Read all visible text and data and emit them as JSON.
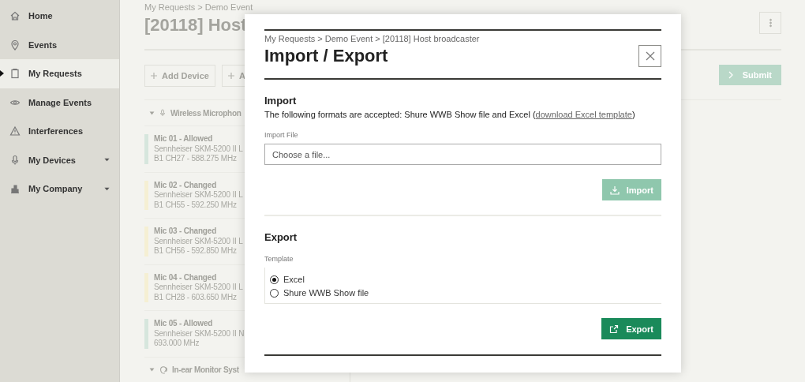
{
  "sidebar": {
    "items": [
      {
        "label": "Home",
        "selected": false,
        "submenu": false
      },
      {
        "label": "Events",
        "selected": false,
        "submenu": false
      },
      {
        "label": "My Requests",
        "selected": true,
        "submenu": false
      },
      {
        "label": "Manage Events",
        "selected": false,
        "submenu": false
      },
      {
        "label": "Interferences",
        "selected": false,
        "submenu": false
      },
      {
        "label": "My Devices",
        "selected": false,
        "submenu": true
      },
      {
        "label": "My Company",
        "selected": false,
        "submenu": true
      }
    ]
  },
  "page": {
    "breadcrumb": "My Requests > Demo Event",
    "title": "[20118] Host",
    "toolbar_buttons": [
      "Add Device",
      "A"
    ],
    "submit": {
      "label": "Submit",
      "disabled": true
    },
    "groups": [
      {
        "label": "Wireless Microphon",
        "expanded": true,
        "items": [
          {
            "name": "Mic 01 - Allowed",
            "model": "Sennheiser SKM-5200 II L",
            "frequency": "B1 CH27 - 588.275 MHz",
            "color": "#d6e6dd"
          },
          {
            "name": "Mic 02 - Changed",
            "model": "Sennheiser SKM-5200 II L",
            "frequency": "B1 CH55 - 592.250 MHz",
            "color": "#f5efd3"
          },
          {
            "name": "Mic 03 - Changed",
            "model": "Sennheiser SKM-5200 II L",
            "frequency": "B1 CH56 - 592.850 MHz",
            "color": "#f5efd3"
          },
          {
            "name": "Mic 04 - Changed",
            "model": "Sennheiser SKM-5200 II L",
            "frequency": "B1 CH28 - 603.650 MHz",
            "color": "#f5efd3"
          },
          {
            "name": "Mic 05 - Allowed",
            "model": "Sennheiser SKM-5200 II N",
            "frequency": "693.000 MHz",
            "color": "#d6e6dd"
          }
        ]
      },
      {
        "label": "In-ear Monitor Syst",
        "expanded": true
      }
    ]
  },
  "dialog": {
    "breadcrumb": "My Requests > Demo Event > [20118] Host broadcaster",
    "title": "Import / Export",
    "import": {
      "heading": "Import",
      "description_before": "The following formats are accepted: Shure WWB Show file and Excel (",
      "link": "download Excel template",
      "description_after": ")",
      "file_label": "Import File",
      "placeholder": "Choose a file...",
      "button": {
        "label": "Import",
        "disabled": true
      }
    },
    "export": {
      "heading": "Export",
      "template_label": "Template",
      "options": [
        {
          "label": "Excel",
          "selected": true
        },
        {
          "label": "Shure WWB Show file",
          "selected": false
        }
      ],
      "button": {
        "label": "Export",
        "disabled": false
      }
    }
  }
}
